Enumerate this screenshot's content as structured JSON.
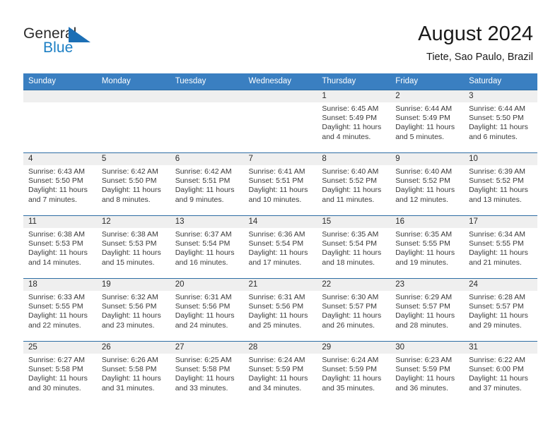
{
  "brand": {
    "name_top": "General",
    "name_bottom": "Blue",
    "accent_color": "#1c7fc4",
    "flag_icon": "triangle-flag-icon"
  },
  "header": {
    "title": "August 2024",
    "subtitle": "Tiete, Sao Paulo, Brazil"
  },
  "theme": {
    "header_bg": "#3a7fc1",
    "row_divider": "#2e6da4",
    "daynum_bg": "#efefef",
    "text": "#3a3a3a"
  },
  "weekday_headers": [
    "Sunday",
    "Monday",
    "Tuesday",
    "Wednesday",
    "Thursday",
    "Friday",
    "Saturday"
  ],
  "weeks": [
    [
      {
        "day": "",
        "sunrise": "",
        "sunset": "",
        "daylight_line1": "",
        "daylight_line2": ""
      },
      {
        "day": "",
        "sunrise": "",
        "sunset": "",
        "daylight_line1": "",
        "daylight_line2": ""
      },
      {
        "day": "",
        "sunrise": "",
        "sunset": "",
        "daylight_line1": "",
        "daylight_line2": ""
      },
      {
        "day": "",
        "sunrise": "",
        "sunset": "",
        "daylight_line1": "",
        "daylight_line2": ""
      },
      {
        "day": "1",
        "sunrise": "Sunrise: 6:45 AM",
        "sunset": "Sunset: 5:49 PM",
        "daylight_line1": "Daylight: 11 hours",
        "daylight_line2": "and 4 minutes."
      },
      {
        "day": "2",
        "sunrise": "Sunrise: 6:44 AM",
        "sunset": "Sunset: 5:49 PM",
        "daylight_line1": "Daylight: 11 hours",
        "daylight_line2": "and 5 minutes."
      },
      {
        "day": "3",
        "sunrise": "Sunrise: 6:44 AM",
        "sunset": "Sunset: 5:50 PM",
        "daylight_line1": "Daylight: 11 hours",
        "daylight_line2": "and 6 minutes."
      }
    ],
    [
      {
        "day": "4",
        "sunrise": "Sunrise: 6:43 AM",
        "sunset": "Sunset: 5:50 PM",
        "daylight_line1": "Daylight: 11 hours",
        "daylight_line2": "and 7 minutes."
      },
      {
        "day": "5",
        "sunrise": "Sunrise: 6:42 AM",
        "sunset": "Sunset: 5:50 PM",
        "daylight_line1": "Daylight: 11 hours",
        "daylight_line2": "and 8 minutes."
      },
      {
        "day": "6",
        "sunrise": "Sunrise: 6:42 AM",
        "sunset": "Sunset: 5:51 PM",
        "daylight_line1": "Daylight: 11 hours",
        "daylight_line2": "and 9 minutes."
      },
      {
        "day": "7",
        "sunrise": "Sunrise: 6:41 AM",
        "sunset": "Sunset: 5:51 PM",
        "daylight_line1": "Daylight: 11 hours",
        "daylight_line2": "and 10 minutes."
      },
      {
        "day": "8",
        "sunrise": "Sunrise: 6:40 AM",
        "sunset": "Sunset: 5:52 PM",
        "daylight_line1": "Daylight: 11 hours",
        "daylight_line2": "and 11 minutes."
      },
      {
        "day": "9",
        "sunrise": "Sunrise: 6:40 AM",
        "sunset": "Sunset: 5:52 PM",
        "daylight_line1": "Daylight: 11 hours",
        "daylight_line2": "and 12 minutes."
      },
      {
        "day": "10",
        "sunrise": "Sunrise: 6:39 AM",
        "sunset": "Sunset: 5:52 PM",
        "daylight_line1": "Daylight: 11 hours",
        "daylight_line2": "and 13 minutes."
      }
    ],
    [
      {
        "day": "11",
        "sunrise": "Sunrise: 6:38 AM",
        "sunset": "Sunset: 5:53 PM",
        "daylight_line1": "Daylight: 11 hours",
        "daylight_line2": "and 14 minutes."
      },
      {
        "day": "12",
        "sunrise": "Sunrise: 6:38 AM",
        "sunset": "Sunset: 5:53 PM",
        "daylight_line1": "Daylight: 11 hours",
        "daylight_line2": "and 15 minutes."
      },
      {
        "day": "13",
        "sunrise": "Sunrise: 6:37 AM",
        "sunset": "Sunset: 5:54 PM",
        "daylight_line1": "Daylight: 11 hours",
        "daylight_line2": "and 16 minutes."
      },
      {
        "day": "14",
        "sunrise": "Sunrise: 6:36 AM",
        "sunset": "Sunset: 5:54 PM",
        "daylight_line1": "Daylight: 11 hours",
        "daylight_line2": "and 17 minutes."
      },
      {
        "day": "15",
        "sunrise": "Sunrise: 6:35 AM",
        "sunset": "Sunset: 5:54 PM",
        "daylight_line1": "Daylight: 11 hours",
        "daylight_line2": "and 18 minutes."
      },
      {
        "day": "16",
        "sunrise": "Sunrise: 6:35 AM",
        "sunset": "Sunset: 5:55 PM",
        "daylight_line1": "Daylight: 11 hours",
        "daylight_line2": "and 19 minutes."
      },
      {
        "day": "17",
        "sunrise": "Sunrise: 6:34 AM",
        "sunset": "Sunset: 5:55 PM",
        "daylight_line1": "Daylight: 11 hours",
        "daylight_line2": "and 21 minutes."
      }
    ],
    [
      {
        "day": "18",
        "sunrise": "Sunrise: 6:33 AM",
        "sunset": "Sunset: 5:55 PM",
        "daylight_line1": "Daylight: 11 hours",
        "daylight_line2": "and 22 minutes."
      },
      {
        "day": "19",
        "sunrise": "Sunrise: 6:32 AM",
        "sunset": "Sunset: 5:56 PM",
        "daylight_line1": "Daylight: 11 hours",
        "daylight_line2": "and 23 minutes."
      },
      {
        "day": "20",
        "sunrise": "Sunrise: 6:31 AM",
        "sunset": "Sunset: 5:56 PM",
        "daylight_line1": "Daylight: 11 hours",
        "daylight_line2": "and 24 minutes."
      },
      {
        "day": "21",
        "sunrise": "Sunrise: 6:31 AM",
        "sunset": "Sunset: 5:56 PM",
        "daylight_line1": "Daylight: 11 hours",
        "daylight_line2": "and 25 minutes."
      },
      {
        "day": "22",
        "sunrise": "Sunrise: 6:30 AM",
        "sunset": "Sunset: 5:57 PM",
        "daylight_line1": "Daylight: 11 hours",
        "daylight_line2": "and 26 minutes."
      },
      {
        "day": "23",
        "sunrise": "Sunrise: 6:29 AM",
        "sunset": "Sunset: 5:57 PM",
        "daylight_line1": "Daylight: 11 hours",
        "daylight_line2": "and 28 minutes."
      },
      {
        "day": "24",
        "sunrise": "Sunrise: 6:28 AM",
        "sunset": "Sunset: 5:57 PM",
        "daylight_line1": "Daylight: 11 hours",
        "daylight_line2": "and 29 minutes."
      }
    ],
    [
      {
        "day": "25",
        "sunrise": "Sunrise: 6:27 AM",
        "sunset": "Sunset: 5:58 PM",
        "daylight_line1": "Daylight: 11 hours",
        "daylight_line2": "and 30 minutes."
      },
      {
        "day": "26",
        "sunrise": "Sunrise: 6:26 AM",
        "sunset": "Sunset: 5:58 PM",
        "daylight_line1": "Daylight: 11 hours",
        "daylight_line2": "and 31 minutes."
      },
      {
        "day": "27",
        "sunrise": "Sunrise: 6:25 AM",
        "sunset": "Sunset: 5:58 PM",
        "daylight_line1": "Daylight: 11 hours",
        "daylight_line2": "and 33 minutes."
      },
      {
        "day": "28",
        "sunrise": "Sunrise: 6:24 AM",
        "sunset": "Sunset: 5:59 PM",
        "daylight_line1": "Daylight: 11 hours",
        "daylight_line2": "and 34 minutes."
      },
      {
        "day": "29",
        "sunrise": "Sunrise: 6:24 AM",
        "sunset": "Sunset: 5:59 PM",
        "daylight_line1": "Daylight: 11 hours",
        "daylight_line2": "and 35 minutes."
      },
      {
        "day": "30",
        "sunrise": "Sunrise: 6:23 AM",
        "sunset": "Sunset: 5:59 PM",
        "daylight_line1": "Daylight: 11 hours",
        "daylight_line2": "and 36 minutes."
      },
      {
        "day": "31",
        "sunrise": "Sunrise: 6:22 AM",
        "sunset": "Sunset: 6:00 PM",
        "daylight_line1": "Daylight: 11 hours",
        "daylight_line2": "and 37 minutes."
      }
    ]
  ]
}
